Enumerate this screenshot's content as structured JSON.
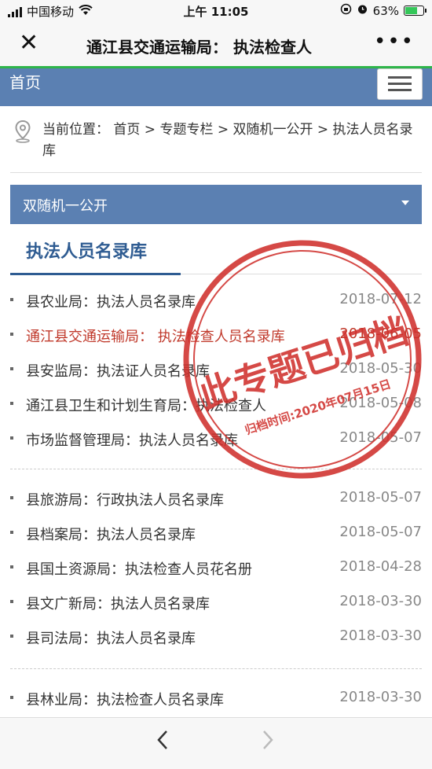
{
  "status_bar": {
    "carrier": "中国移动",
    "time": "上午 11:05",
    "battery": "63%",
    "battery_level": 0.63,
    "icons": [
      "wifi-icon",
      "rotation-lock-icon",
      "alarm-icon",
      "battery-charging-icon"
    ]
  },
  "wechat": {
    "close_icon": "close-icon",
    "title": "通江县交通运输局： 执法检查人",
    "more_icon": "more-icon"
  },
  "nav": {
    "home": "首页",
    "menu_icon": "hamburger-icon"
  },
  "breadcrumb": {
    "text": "当前位置： 首页 > 专题专栏 > 双随机一公开 > 执法人员名录库",
    "icon": "location-pin-icon"
  },
  "section": {
    "label": "双随机一公开",
    "icon": "caret-down-icon"
  },
  "tab": {
    "title": "执法人员名录库"
  },
  "stamp": {
    "main": "此专题已归档",
    "sub": "归档时间:2020年07月15日",
    "color": "#d0312d"
  },
  "list_groups": [
    [
      {
        "title": "县农业局：执法人员名录库",
        "date": "2018-07-12"
      },
      {
        "title": "通江县交通运输局： 执法检查人员名录库",
        "date": "2018-06-05",
        "active": true
      },
      {
        "title": "县安监局：执法证人员名录库",
        "date": "2018-05-30"
      },
      {
        "title": "通江县卫生和计划生育局：执法检查人",
        "date": "2018-05-08"
      },
      {
        "title": "市场监督管理局：执法人员名录库",
        "date": "2018-05-07"
      }
    ],
    [
      {
        "title": "县旅游局：行政执法人员名录库",
        "date": "2018-05-07"
      },
      {
        "title": "县档案局：执法人员名录库",
        "date": "2018-05-07"
      },
      {
        "title": "县国土资源局：执法检查人员花名册",
        "date": "2018-04-28"
      },
      {
        "title": "县文广新局：执法人员名录库",
        "date": "2018-03-30"
      },
      {
        "title": "县司法局：执法人员名录库",
        "date": "2018-03-30"
      }
    ],
    [
      {
        "title": "县林业局：执法检查人员名录库",
        "date": "2018-03-30"
      }
    ]
  ],
  "bottom": {
    "back_icon": "chevron-left-icon",
    "forward_icon": "chevron-right-icon"
  },
  "colors": {
    "accent": "#5b80b2",
    "title_blue": "#2f5c92",
    "active_red": "#c0392b",
    "wechat_green": "#2fb54a"
  }
}
